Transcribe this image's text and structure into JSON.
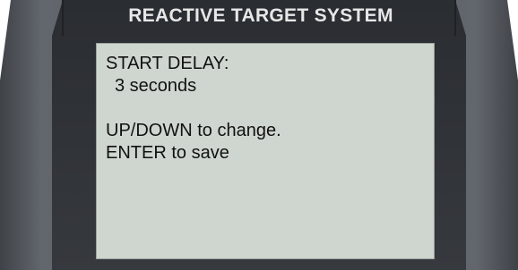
{
  "device": {
    "title": "REACTIVE TARGET SYSTEM",
    "colors": {
      "outer_body": "#555a62",
      "inner_bezel": "#2f3236",
      "lcd_background": "#cfd6cf",
      "lcd_text": "#111111",
      "title_text": "#e7e7e7"
    }
  },
  "screen": {
    "heading": "START DELAY:",
    "value": "3 seconds",
    "instruction_1": "UP/DOWN to change.",
    "instruction_2": "ENTER to save"
  }
}
